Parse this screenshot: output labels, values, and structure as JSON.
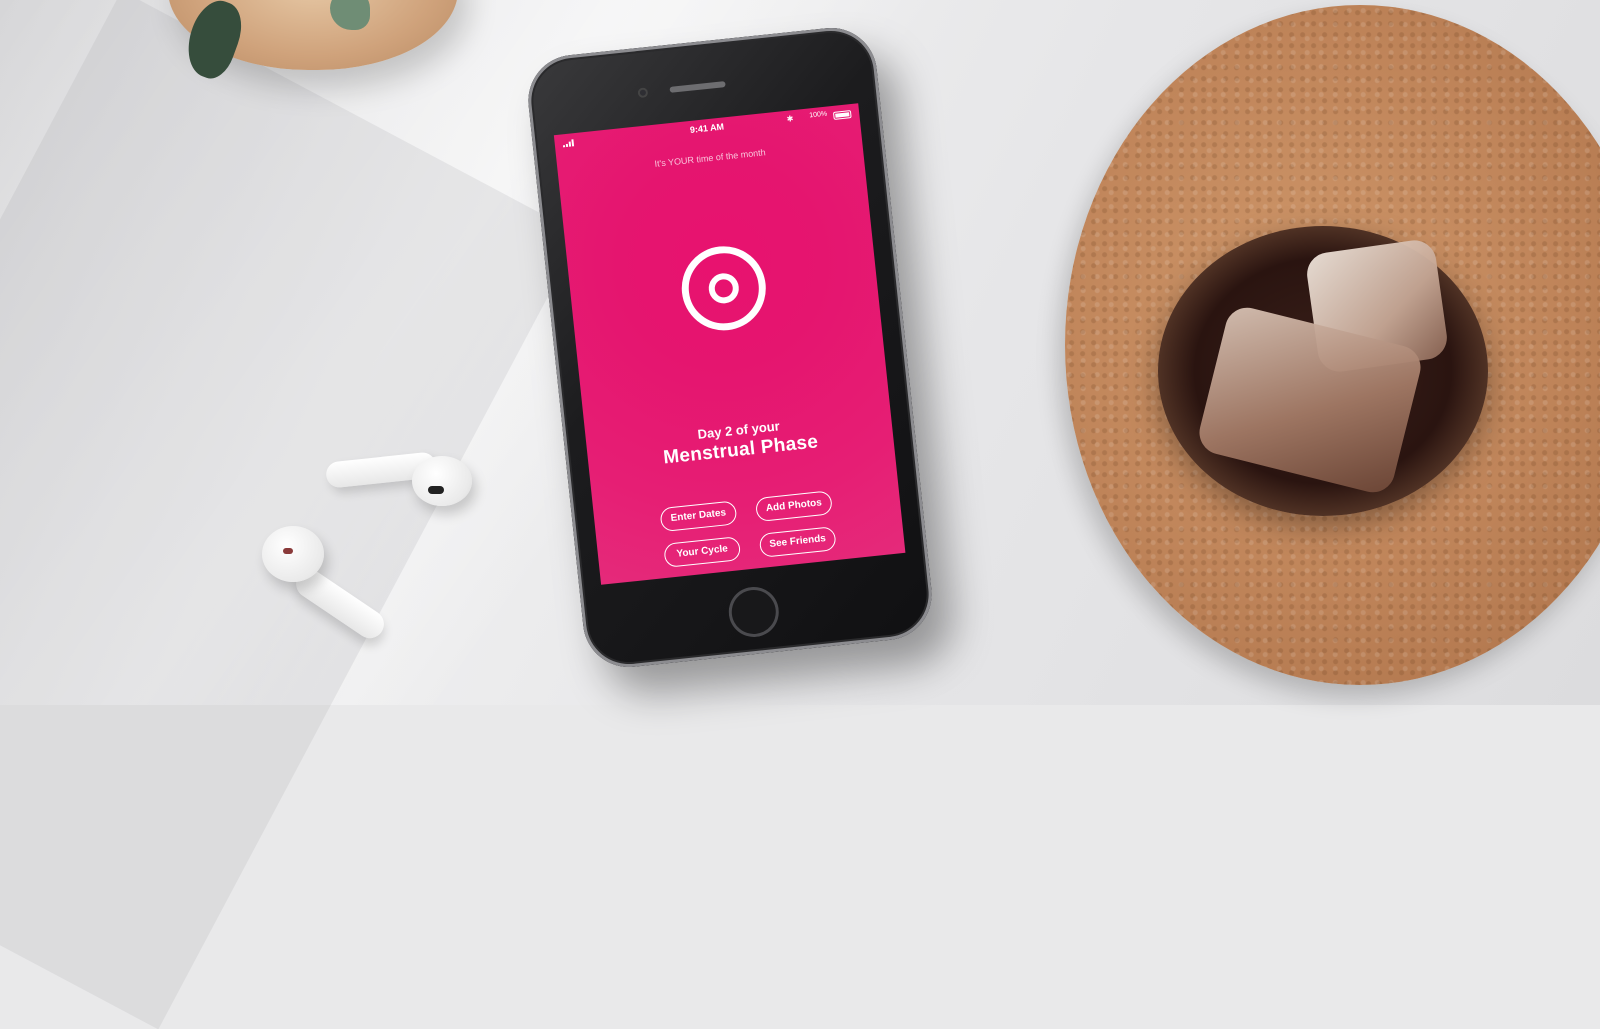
{
  "status_bar": {
    "time": "9:41 AM",
    "battery_percent": "100%",
    "signal_icon": "signal-bars-icon",
    "wifi_icon": "wifi-icon",
    "bluetooth_icon": "bluetooth-icon"
  },
  "app": {
    "subtitle": "It's YOUR time of the month",
    "cycle_icon": "target-ring-icon",
    "day_label": "Day 2 of your",
    "phase_label": "Menstrual Phase",
    "accent_color": "#e8176f"
  },
  "actions": [
    {
      "label": "Enter Dates"
    },
    {
      "label": "Add Photos"
    },
    {
      "label": "Your Cycle"
    },
    {
      "label": "See Friends"
    }
  ]
}
